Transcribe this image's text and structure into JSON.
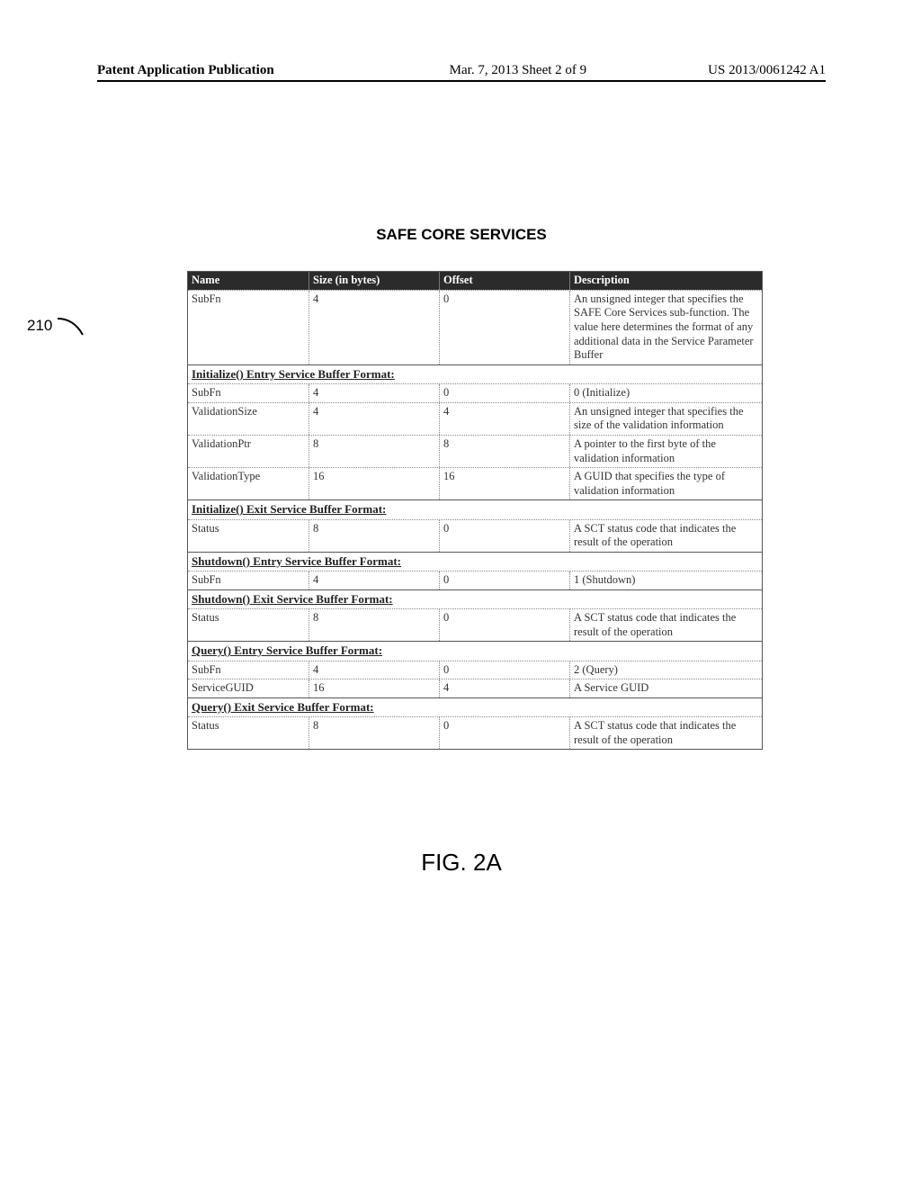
{
  "header": {
    "left": "Patent Application Publication",
    "mid": "Mar. 7, 2013  Sheet 2 of 9",
    "right": "US 2013/0061242 A1"
  },
  "title": "SAFE CORE SERVICES",
  "ref": "210",
  "figure": "FIG. 2A",
  "columns": [
    "Name",
    "Size (in bytes)",
    "Offset",
    "Description"
  ],
  "rows": [
    {
      "type": "data",
      "c": [
        "SubFn",
        "4",
        "0",
        "An unsigned integer that specifies the SAFE Core Services sub-function.  The value here determines the format of any additional data in the Service Parameter Buffer"
      ]
    },
    {
      "type": "sect",
      "label": "Initialize() Entry Service Buffer Format:"
    },
    {
      "type": "data",
      "c": [
        "SubFn",
        "4",
        "0",
        "0 (Initialize)"
      ]
    },
    {
      "type": "data",
      "c": [
        "ValidationSize",
        "4",
        "4",
        "An unsigned integer that specifies the size of the validation information"
      ]
    },
    {
      "type": "data",
      "c": [
        "ValidationPtr",
        "8",
        "8",
        "A pointer to the first byte of the validation information"
      ]
    },
    {
      "type": "data",
      "c": [
        "ValidationType",
        "16",
        "16",
        "A GUID that specifies the type of validation information"
      ]
    },
    {
      "type": "sect",
      "label": "Initialize() Exit Service Buffer Format:"
    },
    {
      "type": "data",
      "c": [
        "Status",
        "8",
        "0",
        "A SCT status code that indicates the result of the operation"
      ]
    },
    {
      "type": "sect",
      "label": "Shutdown() Entry Service Buffer Format:"
    },
    {
      "type": "data",
      "c": [
        "SubFn",
        "4",
        "0",
        "1 (Shutdown)"
      ]
    },
    {
      "type": "sect",
      "label": "Shutdown() Exit Service Buffer Format:"
    },
    {
      "type": "data",
      "c": [
        "Status",
        "8",
        "0",
        "A SCT status code that indicates the result of the operation"
      ]
    },
    {
      "type": "sect",
      "label": "Query() Entry Service Buffer Format:"
    },
    {
      "type": "data",
      "c": [
        "SubFn",
        "4",
        "0",
        "2 (Query)"
      ]
    },
    {
      "type": "data",
      "c": [
        "ServiceGUID",
        "16",
        "4",
        "A Service GUID"
      ]
    },
    {
      "type": "sect",
      "label": "Query() Exit Service Buffer Format:"
    },
    {
      "type": "data",
      "c": [
        "Status",
        "8",
        "0",
        "A SCT status code that indicates the result of the operation"
      ]
    }
  ]
}
